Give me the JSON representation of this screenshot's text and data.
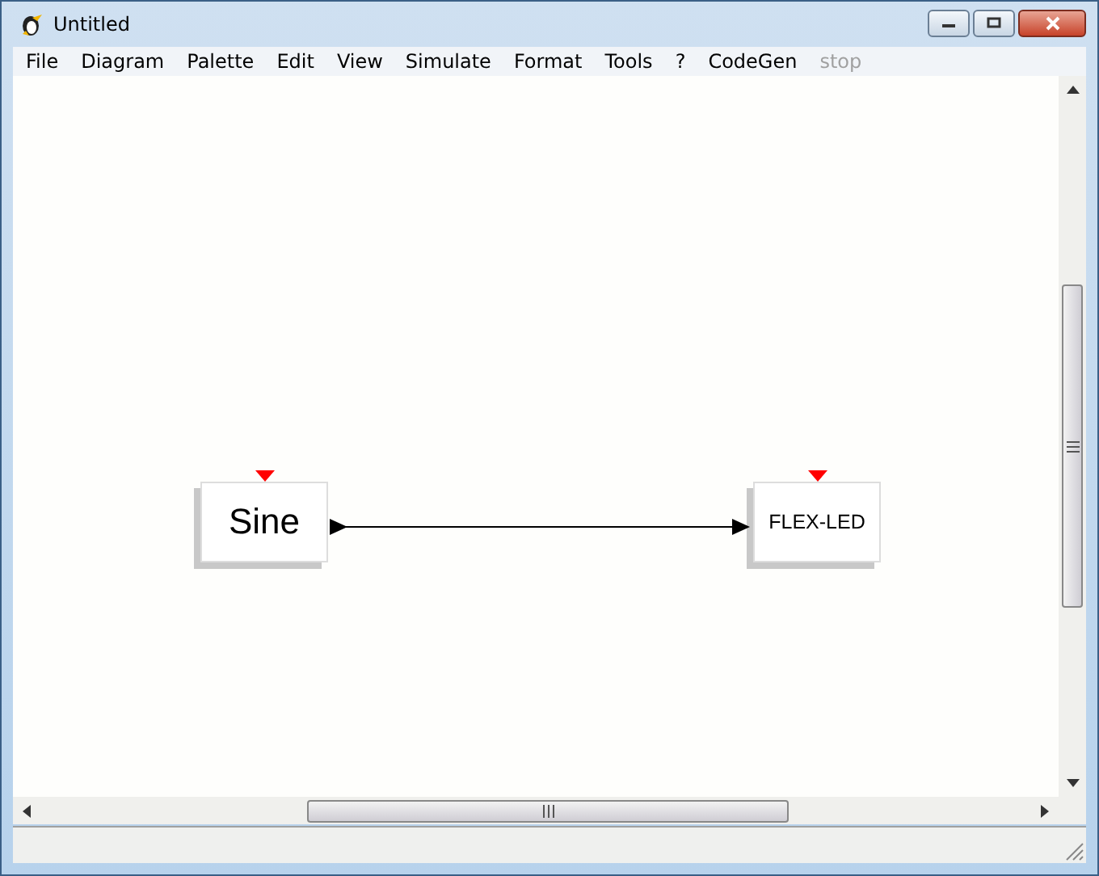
{
  "window": {
    "title": "Untitled"
  },
  "menu": [
    {
      "label": "File",
      "disabled": false
    },
    {
      "label": "Diagram",
      "disabled": false
    },
    {
      "label": "Palette",
      "disabled": false
    },
    {
      "label": "Edit",
      "disabled": false
    },
    {
      "label": "View",
      "disabled": false
    },
    {
      "label": "Simulate",
      "disabled": false
    },
    {
      "label": "Format",
      "disabled": false
    },
    {
      "label": "Tools",
      "disabled": false
    },
    {
      "label": "?",
      "disabled": false
    },
    {
      "label": "CodeGen",
      "disabled": false
    },
    {
      "label": "stop",
      "disabled": true
    }
  ],
  "diagram": {
    "blocks": [
      {
        "label": "Sine",
        "kind": "source"
      },
      {
        "label": "FLEX-LED",
        "kind": "sink"
      }
    ]
  }
}
